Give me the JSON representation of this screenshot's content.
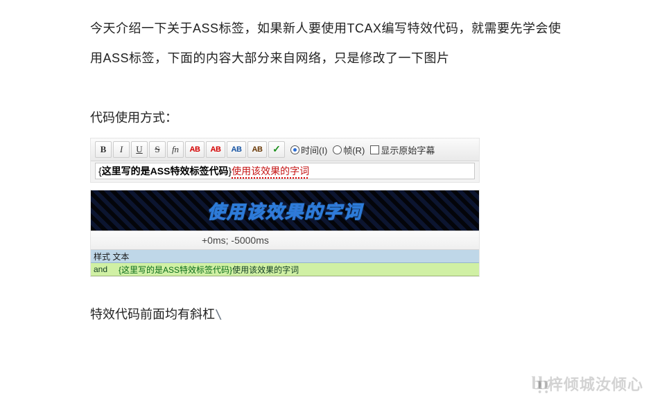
{
  "intro": "今天介绍一下关于ASS标签，如果新人要使用TCAX编写特效代码，就需要先学会使用ASS标签，下面的内容大部分来自网络，只是修改了一下图片",
  "usageHeading": "代码使用方式：",
  "toolbar": {
    "bold": "B",
    "italic": "I",
    "underline": "U",
    "strike": "S",
    "fn": "fn",
    "ab1": "AB",
    "ab2": "AB",
    "ab3": "AB",
    "ab4": "AB",
    "check": "✓",
    "radioTime": "时间(I)",
    "radioFrame": "帧(R)",
    "chkShowRaw": "显示原始字幕"
  },
  "editline": {
    "lbrace": "{",
    "code": "这里写的是ASS特效标签代码",
    "rbrace": "}",
    "applied": "使用该效果的字词"
  },
  "preview": "使用该效果的字词",
  "time": "+0ms; -5000ms",
  "grid": {
    "header": "样式  文本",
    "rowLeft": "and",
    "rowTag": "{这里写的是ASS特效标签代码}",
    "rowText": "使用该效果的字词"
  },
  "note": "特效代码前面均有斜杠",
  "noteSlash": "\\",
  "watermark": "梓倾城汝倾心"
}
